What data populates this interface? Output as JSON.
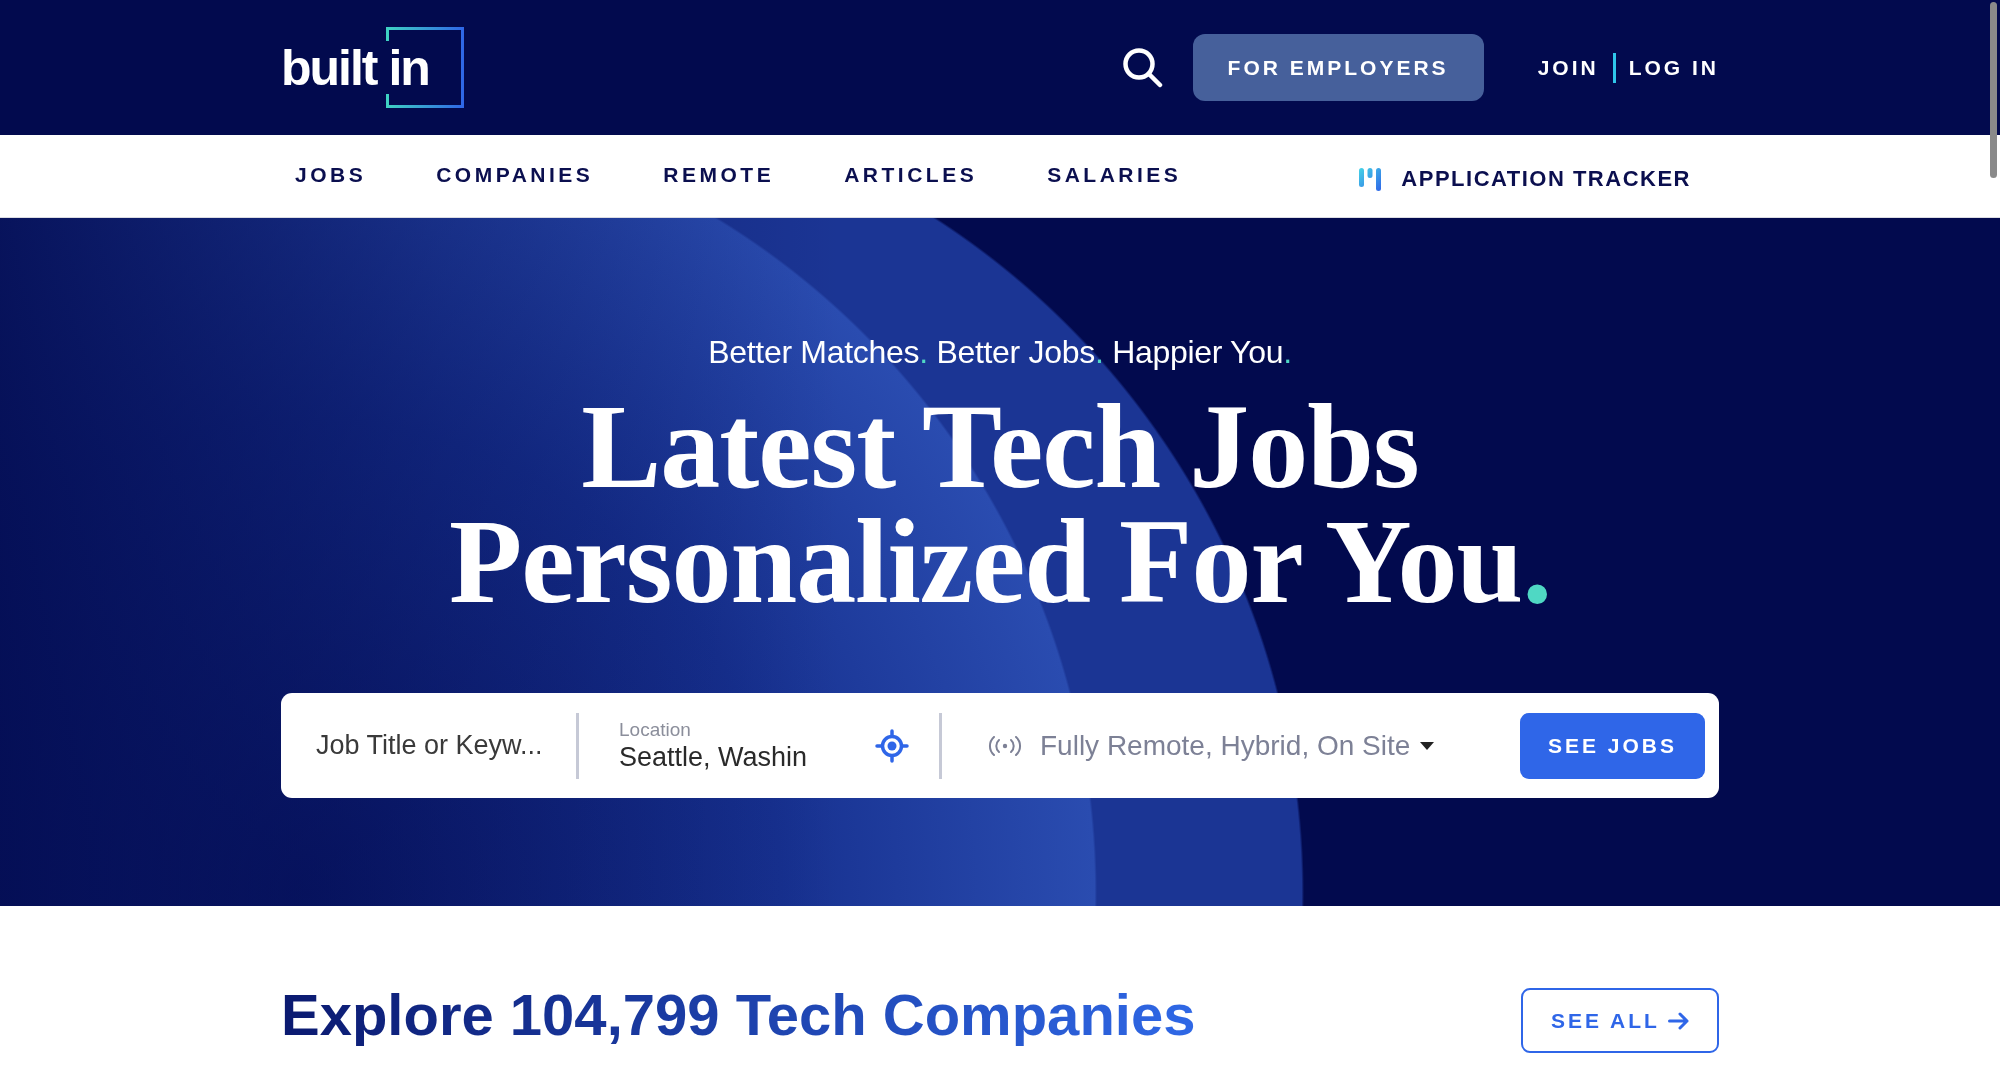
{
  "header": {
    "logo": "built in",
    "employers_button": "FOR EMPLOYERS",
    "account_links": [
      "JOIN",
      "LOG IN"
    ]
  },
  "nav": {
    "items": [
      {
        "label": "JOBS",
        "selected": false
      },
      {
        "label": "COMPANIES",
        "selected": false
      },
      {
        "label": "REMOTE",
        "selected": false
      },
      {
        "label": "ARTICLES",
        "selected": false
      },
      {
        "label": "SALARIES",
        "selected": false
      }
    ],
    "tracker_link": "APPLICATION TRACKER"
  },
  "hero": {
    "tagline": [
      {
        "text": "Better Matches",
        "mark": "."
      },
      {
        "text": "Better Jobs",
        "mark": "."
      },
      {
        "text": "Happier You",
        "mark": "."
      }
    ],
    "headline": {
      "lines": [
        "Latest Tech Jobs",
        "Personalized For You"
      ],
      "mark": "."
    },
    "search": {
      "keyword": {
        "placeholder": "Job Title or Keyw..."
      },
      "location": {
        "label": "Location",
        "value": "Seattle, Washin"
      },
      "work_type": {
        "value": "Fully Remote, Hybrid, On Site"
      },
      "submit_button": "SEE JOBS"
    }
  },
  "companies": {
    "title": "Explore 104,799 Tech Companies",
    "see_all_button": "SEE ALL"
  }
}
